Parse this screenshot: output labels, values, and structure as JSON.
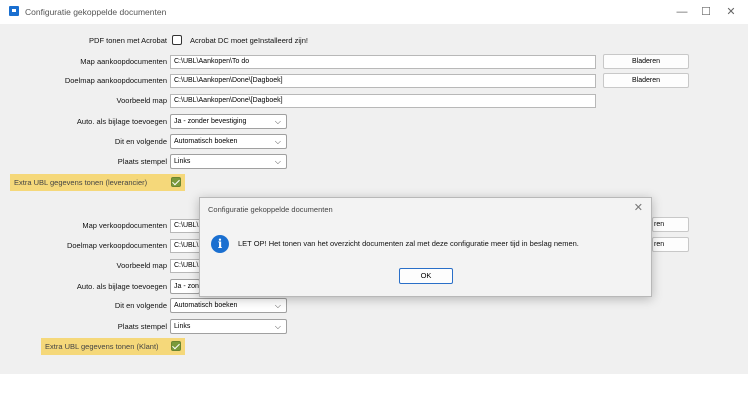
{
  "window": {
    "title": "Configuratie gekoppelde documenten",
    "minimize": "—",
    "maximize": "☐",
    "close": "✕"
  },
  "purchase": {
    "pdf_label": "PDF tonen met Acrobat",
    "pdf_checked": false,
    "pdf_note": "Acrobat DC moet geïnstalleerd zijn!",
    "map_label": "Map aankoopdocumenten",
    "map_value": "C:\\UBL\\Aankopen\\To do",
    "target_label": "Doelmap aankoopdocumenten",
    "target_value": "C:\\UBL\\Aankopen\\Done\\[Dagboek]",
    "example_label": "Voorbeeld map",
    "example_value": "C:\\UBL\\Aankopen\\Done\\[Dagboek]",
    "attach_label": "Auto. als bijlage toevoegen",
    "attach_value": "Ja - zonder bevestiging",
    "next_label": "Dit en volgende",
    "next_value": "Automatisch boeken",
    "stamp_label": "Plaats stempel",
    "stamp_value": "Links",
    "extra_label": "Extra UBL gegevens tonen (leverancier)",
    "extra_checked": true,
    "browse1": "Bladeren",
    "browse2": "Bladeren"
  },
  "sales": {
    "map_label": "Map verkoopdocumenten",
    "map_value": "C:\\UBL\\",
    "target_label": "Doelmap verkoopdocumenten",
    "target_value": "C:\\UBL\\",
    "example_label": "Voorbeeld map",
    "example_value": "C:\\UBL\\",
    "attach_label": "Auto. als bijlage toevoegen",
    "attach_value": "Ja - zon",
    "next_label": "Dit en volgende",
    "next_value": "Automatisch boeken",
    "stamp_label": "Plaats stempel",
    "stamp_value": "Links",
    "extra_label": "Extra UBL gegevens tonen (Klant)",
    "extra_checked": true,
    "browse1": "ren",
    "browse2": "ren"
  },
  "dialog": {
    "title": "Configuratie gekoppelde documenten",
    "message": "LET OP! Het tonen van het overzicht documenten zal met deze configuratie meer tijd in beslag nemen.",
    "ok": "OK",
    "close": "✕",
    "icon": "info-icon"
  },
  "colors": {
    "highlight": "#f5d87a",
    "checkbox_on": "#7a9a3a",
    "info": "#1a6fd0"
  }
}
